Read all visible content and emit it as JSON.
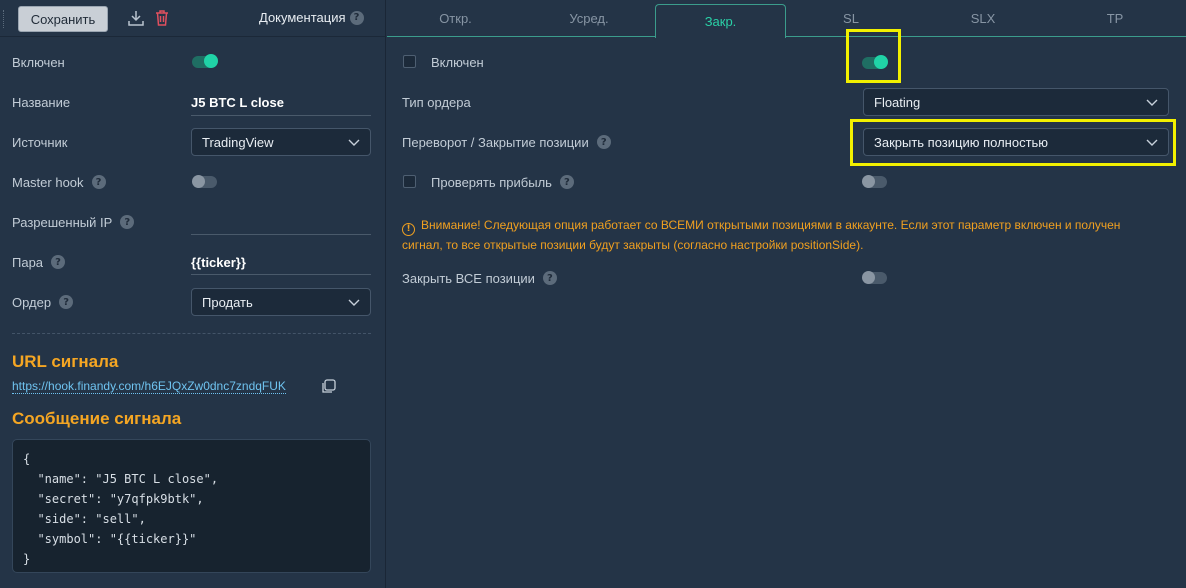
{
  "toolbar": {
    "save_label": "Сохранить",
    "docs_label": "Документация",
    "help_glyph": "?"
  },
  "left": {
    "fields": {
      "enabled": {
        "label": "Включен",
        "on": true
      },
      "name": {
        "label": "Название",
        "value": "J5 BTC L close"
      },
      "source": {
        "label": "Источник",
        "value": "TradingView"
      },
      "master_hook": {
        "label": "Master hook",
        "on": false
      },
      "allowed_ip": {
        "label": "Разрешенный IP",
        "value": ""
      },
      "pair": {
        "label": "Пара",
        "value": "{{ticker}}"
      },
      "order": {
        "label": "Ордер",
        "value": "Продать"
      }
    },
    "signal_url_title": "URL сигнала",
    "signal_url": "https://hook.finandy.com/h6EJQxZw0dnc7zndqFUK",
    "signal_message_title": "Сообщение сигнала",
    "signal_message": "{\n  \"name\": \"J5 BTC L close\",\n  \"secret\": \"y7qfpk9btk\",\n  \"side\": \"sell\",\n  \"symbol\": \"{{ticker}}\"\n}"
  },
  "tabs": [
    {
      "label": "Откр.",
      "active": false
    },
    {
      "label": "Усред.",
      "active": false
    },
    {
      "label": "Закр.",
      "active": true
    },
    {
      "label": "SL",
      "active": false
    },
    {
      "label": "SLX",
      "active": false
    },
    {
      "label": "TP",
      "active": false
    }
  ],
  "close_panel": {
    "enabled": {
      "label": "Включен",
      "checked": false,
      "on": true
    },
    "order_type": {
      "label": "Тип ордера",
      "value": "Floating"
    },
    "reverse_close": {
      "label": "Переворот / Закрытие позиции",
      "value": "Закрыть позицию полностью"
    },
    "check_profit": {
      "label": "Проверять прибыль",
      "checked": false,
      "on": false
    },
    "warning": "Внимание! Следующая опция работает со ВСЕМИ открытыми позициями в аккаунте. Если этот параметр включен и получен сигнал, то все открытые позиции будут закрыты (согласно настройки positionSide).",
    "close_all": {
      "label": "Закрыть ВСЕ позиции",
      "on": false
    }
  },
  "colors": {
    "accent": "#20d3a7",
    "warning": "#f0a020",
    "highlight": "#f2f000",
    "heading": "#f5a623"
  }
}
